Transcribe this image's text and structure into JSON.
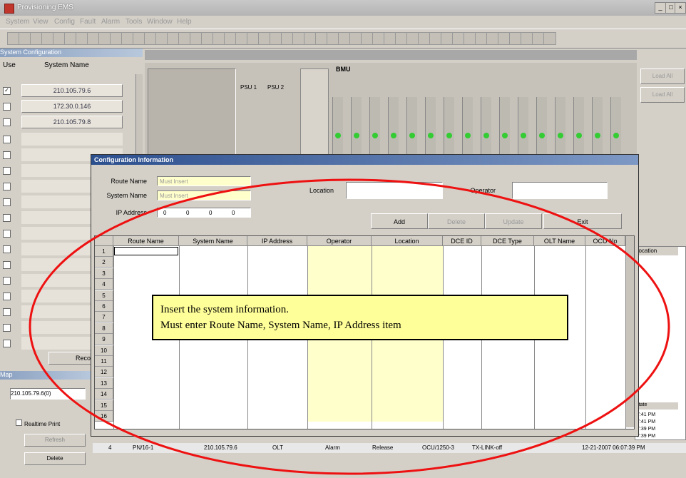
{
  "window": {
    "title": "Provisioning EMS"
  },
  "menu": [
    "System",
    "View",
    "Config",
    "Fault",
    "Alarm",
    "Tools",
    "Window",
    "Help"
  ],
  "system_panel": {
    "title": "System Configuration",
    "col_use": "Use",
    "col_name": "System Name",
    "systems": [
      {
        "name": "210.105.79.6",
        "checked": true
      },
      {
        "name": "172.30.0.146",
        "checked": false
      },
      {
        "name": "210.105.79.8",
        "checked": false
      }
    ],
    "reconnect_label": "Reconne"
  },
  "shelf": {
    "label": "BMU",
    "psu1": "PSU 1",
    "psu2": "PSU 2"
  },
  "side_buttons": [
    "Load All",
    "Load All"
  ],
  "map_panel": {
    "title": "Map",
    "selected_ip": "210.105.79.6(0)",
    "realtime_label": "Realtime Print",
    "refresh_label": "Refresh",
    "delete_label": "Delete"
  },
  "dialog": {
    "title": "Configuration Information",
    "route_name_label": "Route Name",
    "system_name_label": "System Name",
    "ip_address_label": "IP Address",
    "route_name_placeholder": "Must Insert",
    "system_name_placeholder": "Must Insert",
    "ip_octets": [
      "0",
      "0",
      "0",
      "0"
    ],
    "location_label": "Location",
    "operator_label": "Operator",
    "buttons": {
      "add": "Add",
      "delete": "Delete",
      "update": "Update",
      "exit": "Exit"
    },
    "columns": [
      "Route Name",
      "System Name",
      "IP Address",
      "Operator",
      "Location",
      "DCE ID",
      "DCE Type",
      "OLT Name",
      "OCU No"
    ],
    "row_numbers": [
      "1",
      "2",
      "3",
      "4",
      "5",
      "6",
      "7",
      "8",
      "9",
      "10",
      "11",
      "12",
      "13",
      "14",
      "15",
      "16"
    ]
  },
  "tooltip": {
    "line1": "Insert the system information.",
    "line2": "Must enter Route Name, System Name, IP Address item"
  },
  "alarm_row": {
    "index": "4",
    "port": "PN/16-1",
    "ip": "210.105.79.6",
    "type": "OLT",
    "category": "Alarm",
    "action": "Release",
    "unit": "OCU/1250-3",
    "link": "TX-LINK-off",
    "time": "12-21-2007 06:07:39 PM"
  },
  "right_list": {
    "header": "Location",
    "col2": "State",
    "times": [
      "7:41 PM",
      "7:41 PM",
      "7:39 PM",
      "7:39 PM"
    ]
  }
}
